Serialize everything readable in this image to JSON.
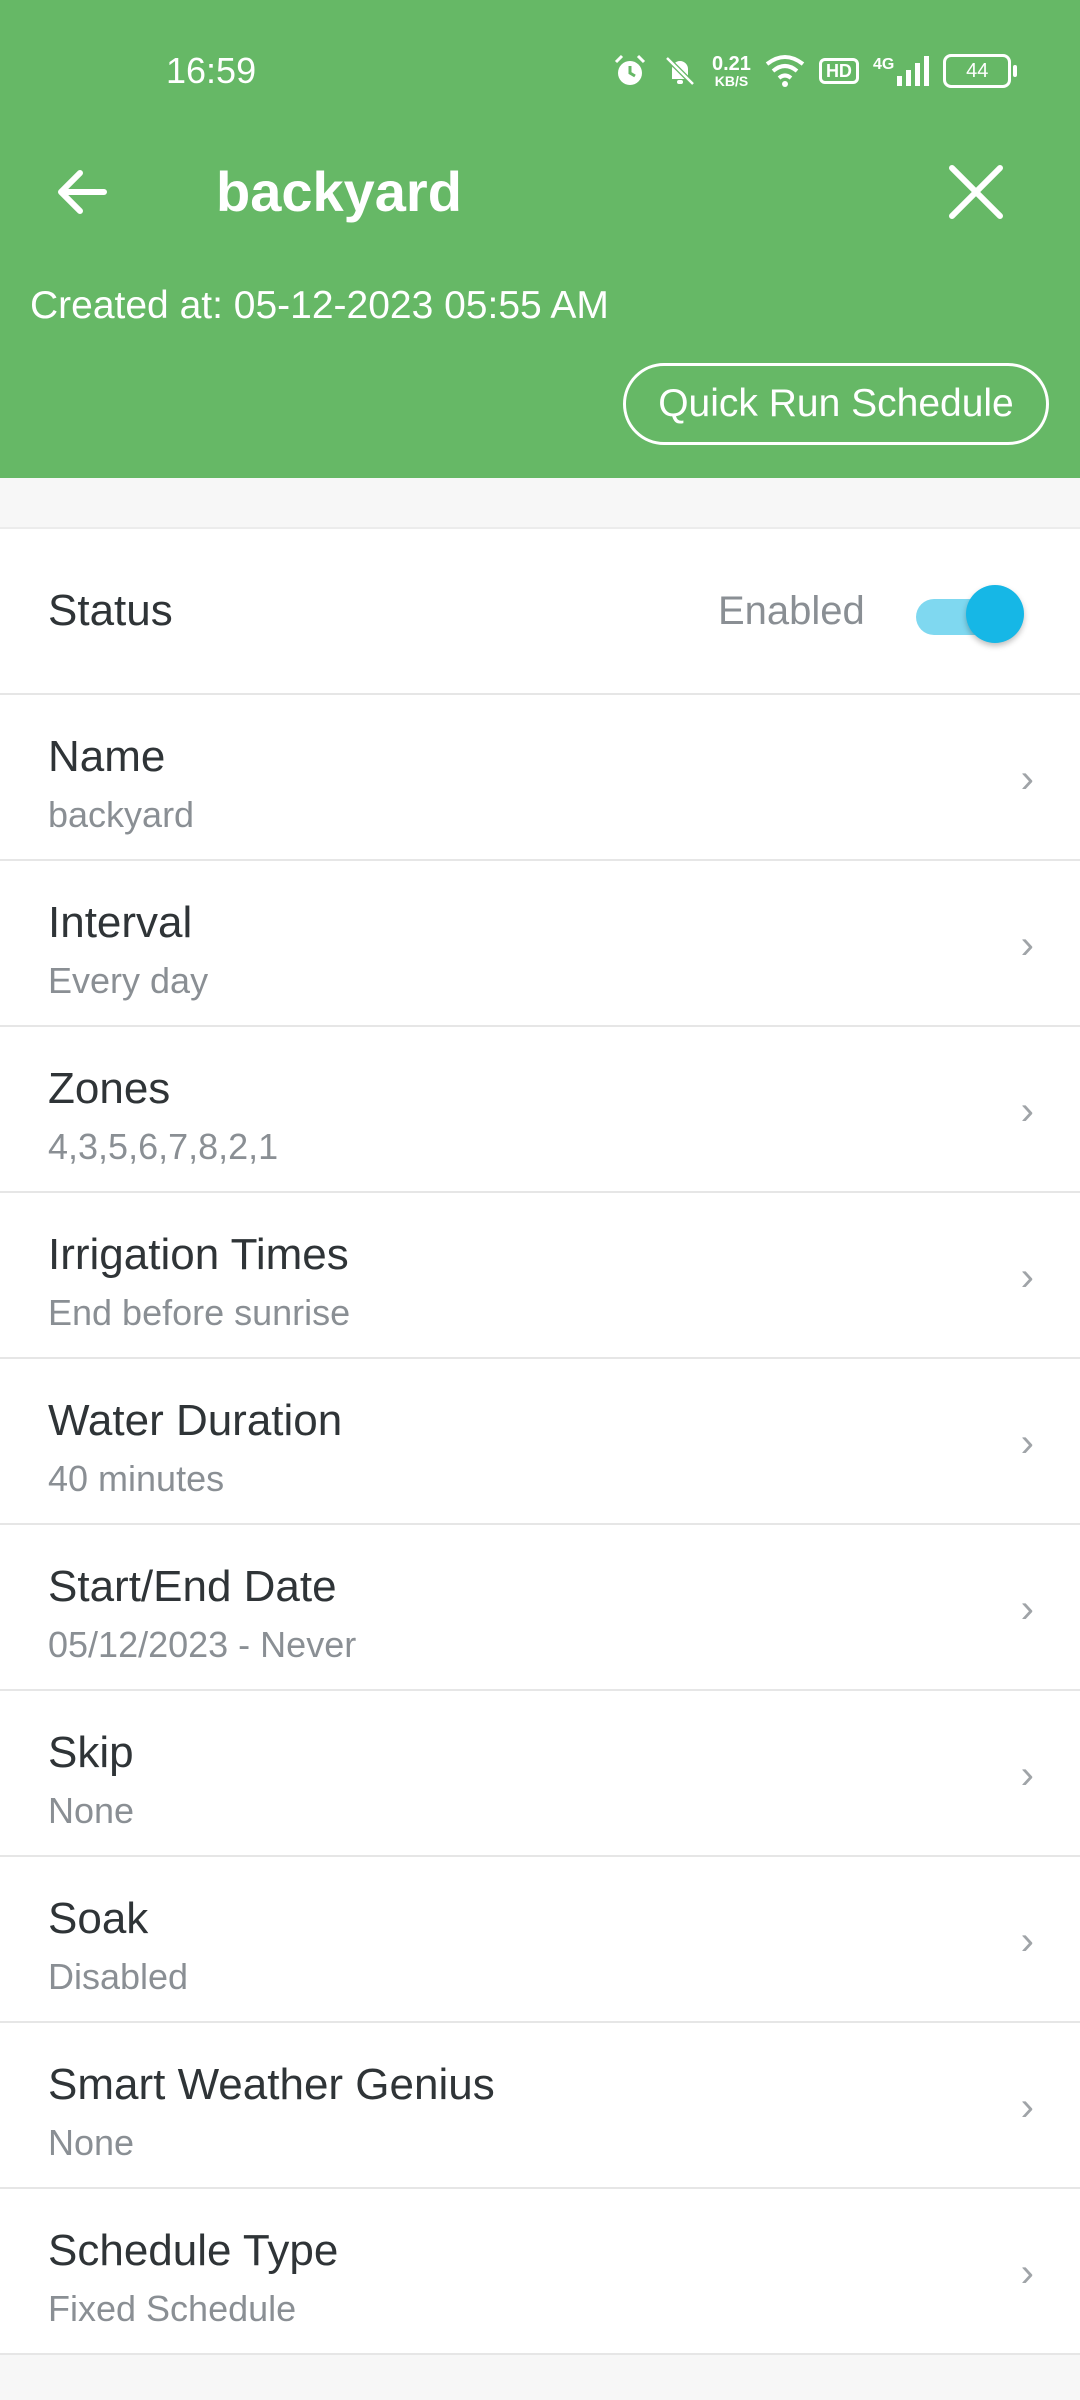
{
  "status_bar": {
    "time": "16:59",
    "speed_value": "0.21",
    "speed_unit": "KB/S",
    "hd_badge": "HD",
    "network_type": "4G",
    "battery": "44"
  },
  "header": {
    "title": "backyard",
    "created_at": "Created at: 05-12-2023 05:55 AM",
    "quick_run_label": "Quick Run Schedule",
    "background_color": "#66b866"
  },
  "status": {
    "label": "Status",
    "value": "Enabled",
    "enabled": true,
    "toggle_color": "#16b7e6"
  },
  "settings": [
    {
      "label": "Name",
      "value": "backyard"
    },
    {
      "label": "Interval",
      "value": "Every day"
    },
    {
      "label": "Zones",
      "value": "4,3,5,6,7,8,2,1"
    },
    {
      "label": "Irrigation Times",
      "value": "End before sunrise"
    },
    {
      "label": "Water Duration",
      "value": "40 minutes"
    },
    {
      "label": "Start/End Date",
      "value": "05/12/2023 - Never"
    },
    {
      "label": "Skip",
      "value": "None"
    },
    {
      "label": "Soak",
      "value": "Disabled"
    },
    {
      "label": "Smart Weather Genius",
      "value": "None"
    },
    {
      "label": "Schedule Type",
      "value": "Fixed Schedule"
    }
  ]
}
